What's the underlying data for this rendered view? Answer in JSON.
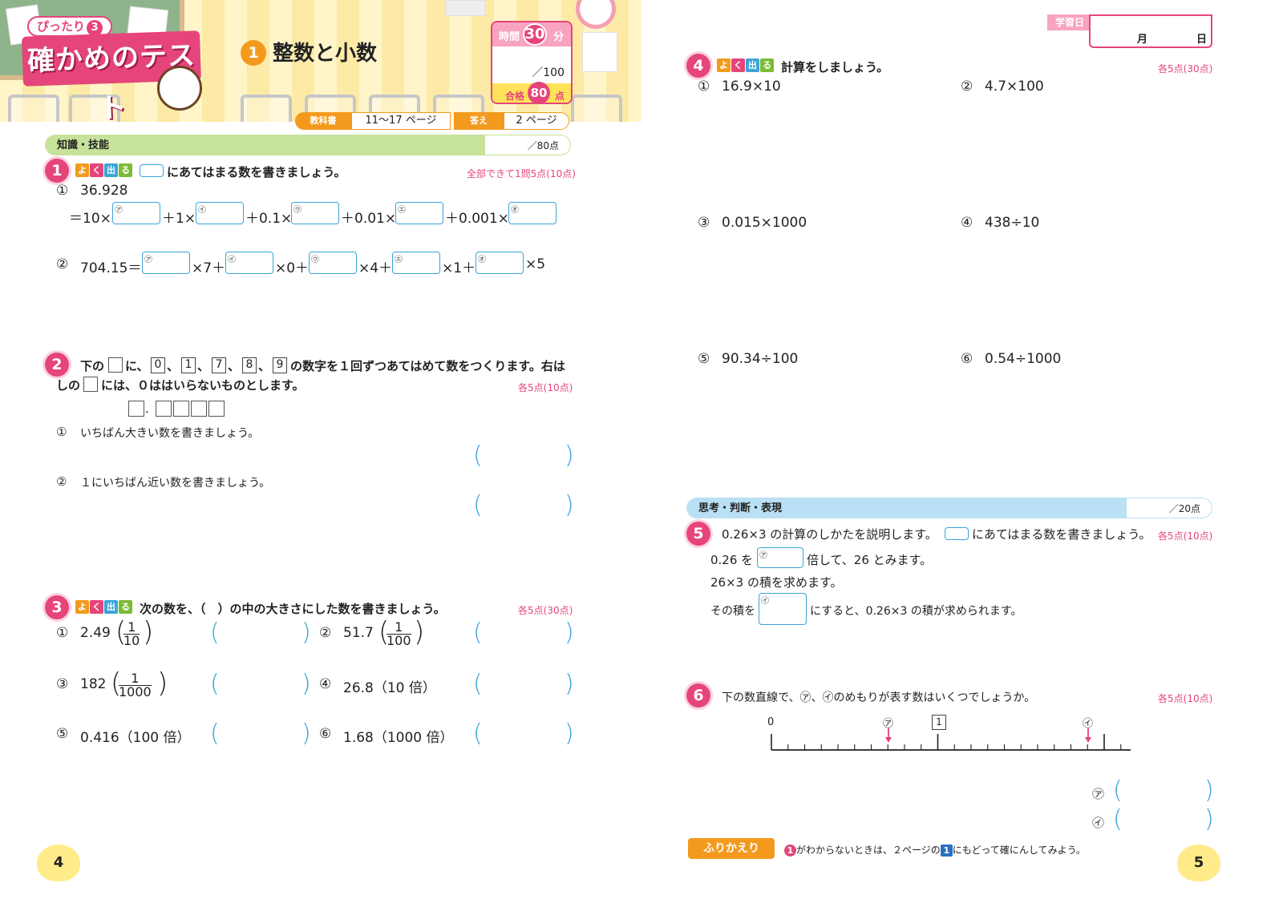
{
  "header": {
    "series_badge": "ぴったり",
    "series_num": "3",
    "test_title": "確かめのテスト",
    "unit_number": "1",
    "unit_title": "整数と小数",
    "timer_label": "時間",
    "timer_minutes": "30",
    "timer_unit": "分",
    "score_total": "／100",
    "pass_label": "合格",
    "pass_score": "80",
    "pass_unit": "点",
    "textbook_label": "教科書",
    "textbook_pages": "11～17 ページ",
    "answer_label": "答え",
    "answer_page": "2 ページ"
  },
  "left_section": {
    "label": "知識・技能",
    "points": "／80点"
  },
  "yoku": [
    "よ",
    "く",
    "出",
    "る"
  ],
  "q1": {
    "num": "1",
    "text": "にあてはまる数を書きましょう。",
    "points": "全部できて1問5点(10点)",
    "p1_label": "①",
    "p1_value": "36.928",
    "p1_eq": "＝10×",
    "p1_t1": "＋1×",
    "p1_t2": "＋0.1×",
    "p1_t3": "＋0.01×",
    "p1_t4": "＋0.001×",
    "p2_label": "②",
    "p2_value": "704.15＝",
    "p2_t1": "×7＋",
    "p2_t2": "×0＋",
    "p2_t3": "×4＋",
    "p2_t4": "×1＋",
    "p2_t5": "×5",
    "kana": [
      "㋐",
      "㋑",
      "㋒",
      "㋓",
      "㋔"
    ]
  },
  "q2": {
    "num": "2",
    "line1_a": "下の",
    "line1_b": "に、",
    "digits": [
      "0",
      "1",
      "7",
      "8",
      "9"
    ],
    "line1_c": "の数字を１回ずつあてはめて数をつくります。右は",
    "line2_a": "しの",
    "line2_b": "には、０ははいらないものとします。",
    "points": "各5点(10点)",
    "dot": ".",
    "sub1_label": "①",
    "sub1_text": "いちばん大きい数を書きましょう。",
    "sub2_label": "②",
    "sub2_text": "１にいちばん近い数を書きましょう。"
  },
  "q3": {
    "num": "3",
    "text": "次の数を、（　）の中の大きさにした数を書きましょう。",
    "points": "各5点(30点)",
    "items": [
      {
        "label": "①",
        "value": "2.49",
        "frac_n": "1",
        "frac_d": "10"
      },
      {
        "label": "②",
        "value": "51.7",
        "frac_n": "1",
        "frac_d": "100"
      },
      {
        "label": "③",
        "value": "182",
        "frac_n": "1",
        "frac_d": "1000"
      },
      {
        "label": "④",
        "value": "26.8（10 倍）"
      },
      {
        "label": "⑤",
        "value": "0.416（100 倍）"
      },
      {
        "label": "⑥",
        "value": "1.68（1000 倍）"
      }
    ]
  },
  "date": {
    "label": "学習日",
    "month": "月",
    "day": "日"
  },
  "q4": {
    "num": "4",
    "text": "計算をしましょう。",
    "points": "各5点(30点)",
    "items": [
      {
        "label": "①",
        "expr": "16.9×10"
      },
      {
        "label": "②",
        "expr": "4.7×100"
      },
      {
        "label": "③",
        "expr": "0.015×1000"
      },
      {
        "label": "④",
        "expr": "438÷10"
      },
      {
        "label": "⑤",
        "expr": "90.34÷100"
      },
      {
        "label": "⑥",
        "expr": "0.54÷1000"
      }
    ]
  },
  "right_section": {
    "label": "思考・判断・表現",
    "points": "／20点"
  },
  "q5": {
    "num": "5",
    "text_a": "0.26×3 の計算のしかたを説明します。",
    "text_b": "にあてはまる数を書きましょう。",
    "points": "各5点(10点)",
    "l1_a": "0.26 を",
    "l1_b": "倍して、26 とみます。",
    "l2": "26×3 の積を求めます。",
    "l3_a": "その積を",
    "l3_b": "にすると、0.26×3 の積が求められます。",
    "kana": [
      "㋐",
      "㋑"
    ]
  },
  "q6": {
    "num": "6",
    "text": "下の数直線で、㋐、㋑のめもりが表す数はいくつでしょうか。",
    "points": "各5点(10点)",
    "zero": "0",
    "one": "1",
    "mark_a": "㋐",
    "mark_b": "㋑",
    "ans_a": "㋐",
    "ans_b": "㋑"
  },
  "footer": {
    "left_page": "4",
    "right_page": "5",
    "furikaeri": "ふりかえり",
    "note_num": "1",
    "note_a": "がわからないときは、２ページの",
    "note_num2": "1",
    "note_b": "にもどって確にんしてみよう。"
  },
  "colors": {
    "accent_pink": "#e5457a",
    "accent_blue": "#3aa4d9",
    "accent_orange": "#f39a1e",
    "section_green": "#c7e29a",
    "section_blue": "#b9e0f5"
  }
}
